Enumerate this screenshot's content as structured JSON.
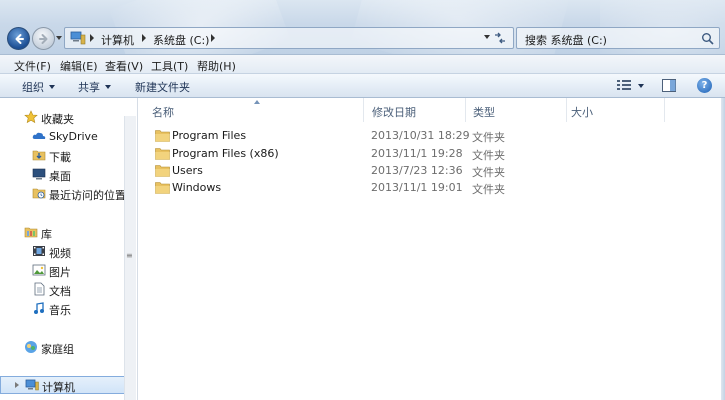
{
  "address_bar": {
    "breadcrumbs": [
      "计算机",
      "系统盘 (C:)"
    ]
  },
  "search": {
    "placeholder": "搜索 系统盘 (C:)"
  },
  "menu": {
    "items": [
      "文件(F)",
      "编辑(E)",
      "查看(V)",
      "工具(T)",
      "帮助(H)"
    ]
  },
  "toolbar": {
    "organize_label": "组织",
    "share_label": "共享",
    "new_folder_label": "新建文件夹",
    "help_glyph": "?"
  },
  "nav_pane": {
    "favorites": {
      "label": "收藏夹",
      "items": [
        {
          "label": "SkyDrive",
          "icon": "cloud-icon"
        },
        {
          "label": "下載",
          "icon": "download-folder-icon"
        },
        {
          "label": "桌面",
          "icon": "desktop-icon"
        },
        {
          "label": "最近访问的位置",
          "icon": "recent-places-icon"
        }
      ]
    },
    "libraries": {
      "label": "库",
      "items": [
        {
          "label": "视频",
          "icon": "video-icon"
        },
        {
          "label": "图片",
          "icon": "pictures-icon"
        },
        {
          "label": "文档",
          "icon": "documents-icon"
        },
        {
          "label": "音乐",
          "icon": "music-icon"
        }
      ]
    },
    "homegroup": {
      "label": "家庭组"
    },
    "computer": {
      "label": "计算机"
    }
  },
  "columns": {
    "name": "名称",
    "modified": "修改日期",
    "type": "类型",
    "size": "大小"
  },
  "files": [
    {
      "name": "Program Files",
      "modified": "2013/10/31 18:29",
      "type": "文件夹",
      "size": ""
    },
    {
      "name": "Program Files (x86)",
      "modified": "2013/11/1 19:28",
      "type": "文件夹",
      "size": ""
    },
    {
      "name": "Users",
      "modified": "2013/7/23 12:36",
      "type": "文件夹",
      "size": ""
    },
    {
      "name": "Windows",
      "modified": "2013/11/1 19:01",
      "type": "文件夹",
      "size": ""
    }
  ],
  "colors": {
    "accent": "#1b5fb5",
    "folder": "#e8c160",
    "header_text": "#4c607a",
    "secondary_text": "#6d6d6d"
  }
}
